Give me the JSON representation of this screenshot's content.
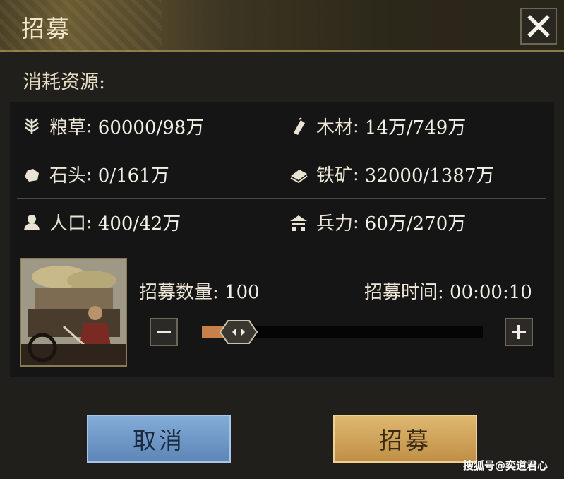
{
  "dialog": {
    "title": "招募",
    "section_label": "消耗资源:"
  },
  "resources": [
    {
      "icon": "grain-icon",
      "name": "粮草",
      "value": "60000/98万"
    },
    {
      "icon": "wood-icon",
      "name": "木材",
      "value": "14万/749万"
    },
    {
      "icon": "stone-icon",
      "name": "石头",
      "value": "0/161万"
    },
    {
      "icon": "iron-icon",
      "name": "铁矿",
      "value": "32000/1387万"
    },
    {
      "icon": "population-icon",
      "name": "人口",
      "value": "400/42万"
    },
    {
      "icon": "troops-icon",
      "name": "兵力",
      "value": "60万/270万"
    }
  ],
  "recruit": {
    "quantity_label": "招募数量:",
    "quantity_value": "100",
    "time_label": "招募时间:",
    "time_value": "00:00:10",
    "slider_level": 0.06
  },
  "buttons": {
    "cancel": "取消",
    "confirm": "招募"
  },
  "watermark": "搜狐号@奕道君心",
  "colors": {
    "cancel_button": "#6f97c8",
    "confirm_button": "#d0a45a",
    "slider_fill": "#c8804a"
  }
}
